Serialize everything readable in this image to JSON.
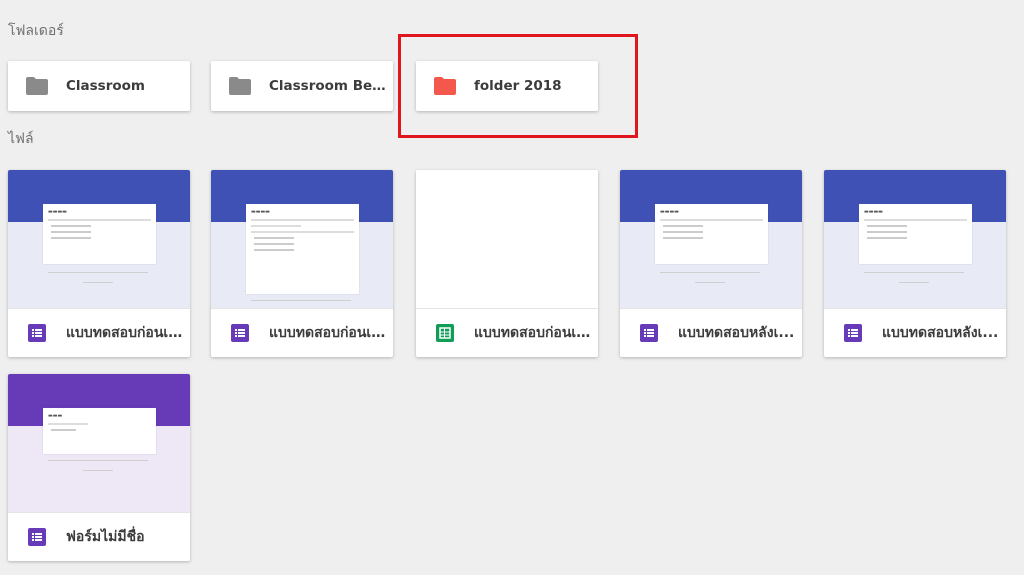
{
  "sections": {
    "folders_label": "โฟลเดอร์",
    "files_label": "ไฟล์"
  },
  "folders": [
    {
      "name": "Classroom",
      "icon": "folder-icon",
      "color": "#8a8a8a"
    },
    {
      "name": "Classroom Benz ...",
      "icon": "folder-icon",
      "color": "#8a8a8a"
    },
    {
      "name": "folder 2018",
      "icon": "folder-icon",
      "color": "#f4584c"
    }
  ],
  "files": [
    {
      "name": "แบบทดสอบก่อนเ...",
      "type": "form",
      "icon": "forms-icon",
      "theme": "#3f51b5"
    },
    {
      "name": "แบบทดสอบก่อนเ...",
      "type": "form",
      "icon": "forms-icon",
      "theme": "#3f51b5"
    },
    {
      "name": "แบบทดสอบก่อนเ...",
      "type": "sheet",
      "icon": "sheets-icon",
      "theme": "#ffffff"
    },
    {
      "name": "แบบทดสอบหลังเ...",
      "type": "form",
      "icon": "forms-icon",
      "theme": "#3f51b5"
    },
    {
      "name": "แบบทดสอบหลังเ...",
      "type": "form",
      "icon": "forms-icon",
      "theme": "#3f51b5"
    },
    {
      "name": "ฟอร์มไม่มีชื่อ",
      "type": "form",
      "icon": "forms-icon",
      "theme": "#673ab7"
    }
  ],
  "colors": {
    "highlight": "#e0161f",
    "forms_icon": "#673ab7",
    "sheets_icon": "#0f9d58"
  }
}
